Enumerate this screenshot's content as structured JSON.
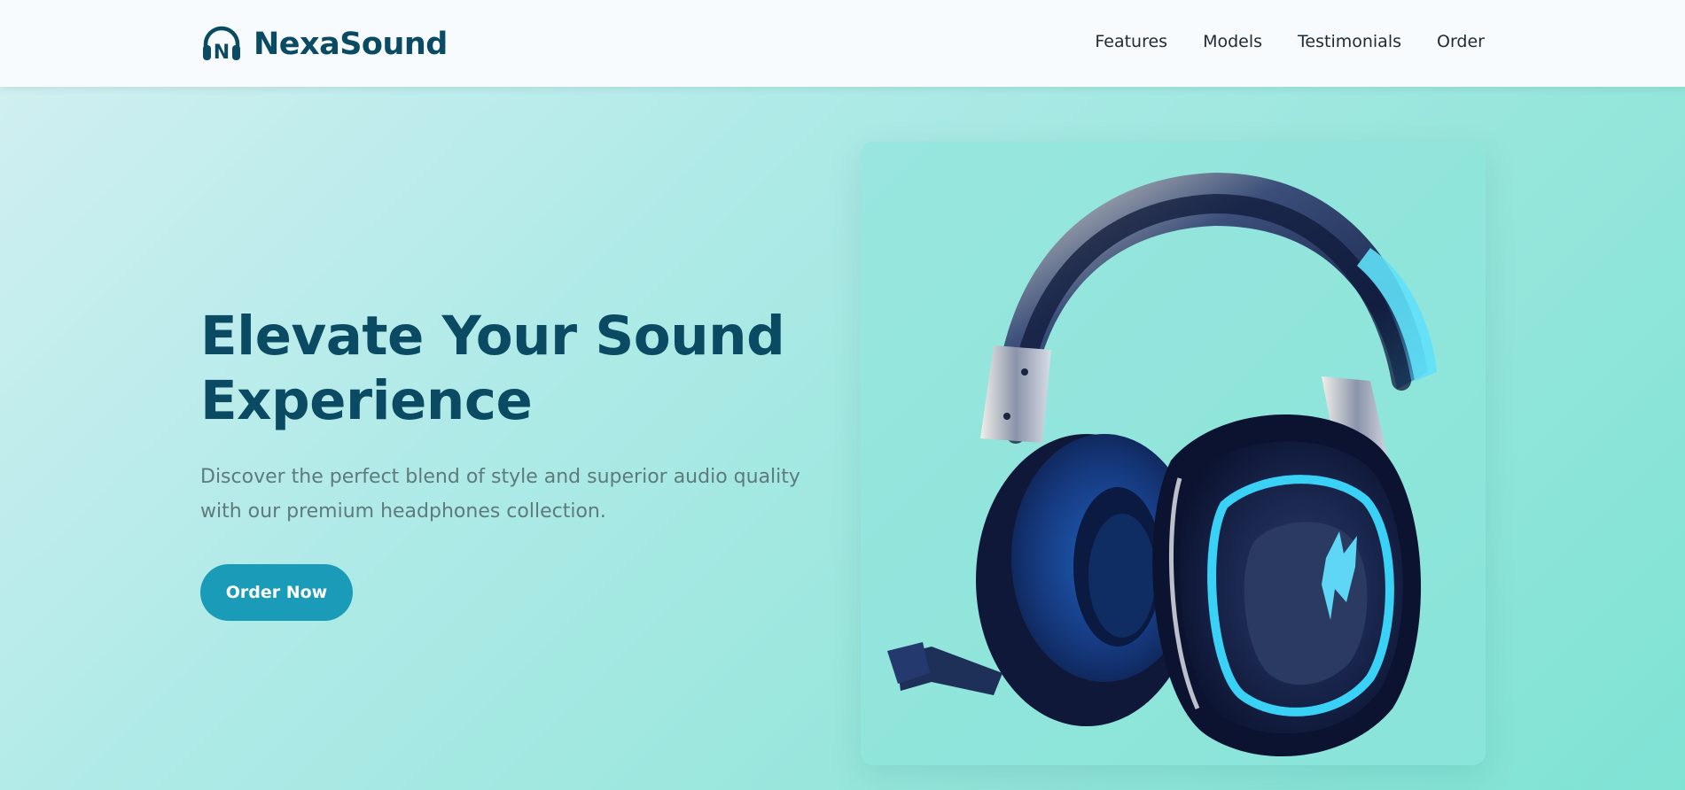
{
  "brand": {
    "name": "NexaSound",
    "icon": "headphones-logo-icon",
    "icon_letter": "N"
  },
  "nav": {
    "items": [
      {
        "label": "Features"
      },
      {
        "label": "Models"
      },
      {
        "label": "Testimonials"
      },
      {
        "label": "Order"
      }
    ]
  },
  "hero": {
    "title_line1": "Elevate Your Sound",
    "title_line2": "Experience",
    "subtitle": "Discover the perfect blend of style and superior audio quality with our premium headphones collection.",
    "cta_label": "Order Now",
    "image_icon": "gaming-headset-image"
  },
  "colors": {
    "brand": "#0b4a63",
    "accent": "#1a9cb8",
    "nav_bg": "#f7fbfd",
    "hero_gradient_start": "#d0eff1",
    "hero_gradient_end": "#7fe3d4",
    "body_text": "#5f7a7c"
  }
}
